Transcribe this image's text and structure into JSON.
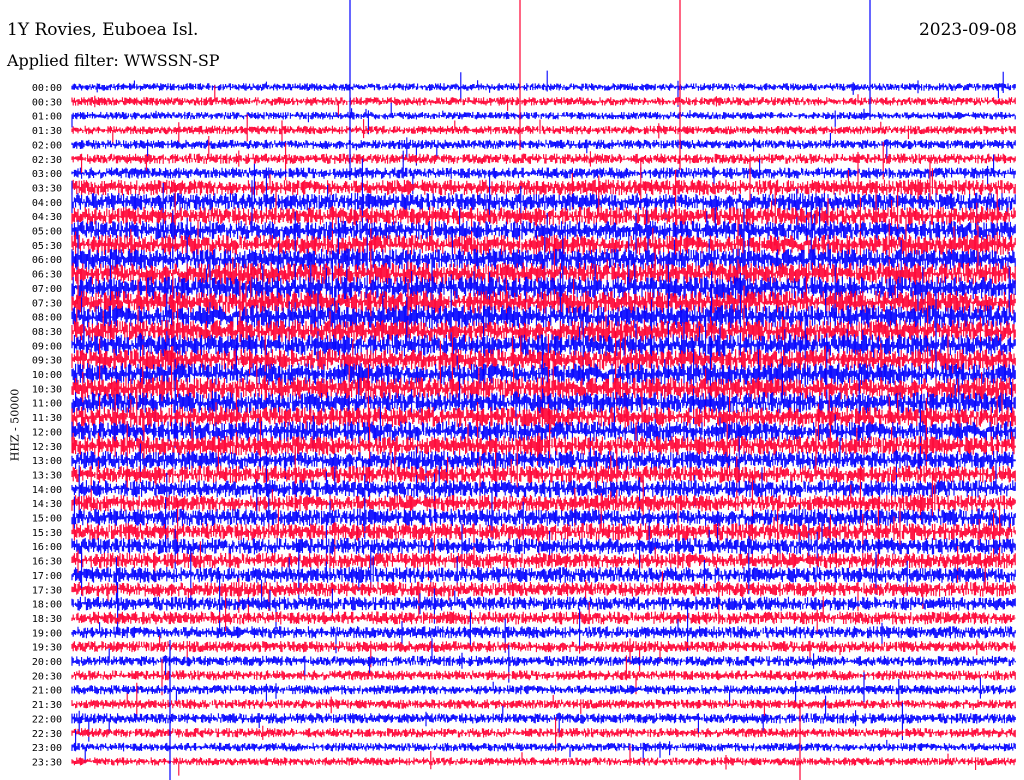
{
  "header": {
    "station": "1Y Rovies, Euboea Isl.",
    "filter": "Applied filter: WWSSN-SP",
    "date": "2023-09-08"
  },
  "chart_data": {
    "type": "line",
    "title": "1Y Rovies, Euboea Isl.",
    "ylabel": "HHZ - 50000",
    "row_labels": [
      "00:00",
      "00:30",
      "01:00",
      "01:30",
      "02:00",
      "02:30",
      "03:00",
      "03:30",
      "04:00",
      "04:30",
      "05:00",
      "05:30",
      "06:00",
      "06:30",
      "07:00",
      "07:30",
      "08:00",
      "08:30",
      "09:00",
      "09:30",
      "10:00",
      "10:30",
      "11:00",
      "11:30",
      "12:00",
      "12:30",
      "13:00",
      "13:30",
      "14:00",
      "14:30",
      "15:00",
      "15:30",
      "16:00",
      "16:30",
      "17:00",
      "17:30",
      "18:00",
      "18:30",
      "19:00",
      "19:30",
      "20:00",
      "20:30",
      "21:00",
      "21:30",
      "22:00",
      "22:30",
      "23:00",
      "23:30"
    ],
    "row_colors": [
      "#0000ff",
      "#ff0033"
    ],
    "activity": [
      0.15,
      0.2,
      0.15,
      0.2,
      0.25,
      0.3,
      0.35,
      0.6,
      0.7,
      0.75,
      0.8,
      0.85,
      0.9,
      0.95,
      1.0,
      1.0,
      1.0,
      0.95,
      0.95,
      0.9,
      0.95,
      0.95,
      0.9,
      0.85,
      0.85,
      0.8,
      0.75,
      0.7,
      0.7,
      0.65,
      0.7,
      0.7,
      0.65,
      0.6,
      0.6,
      0.55,
      0.5,
      0.45,
      0.4,
      0.35,
      0.3,
      0.28,
      0.25,
      0.25,
      0.3,
      0.25,
      0.2,
      0.18
    ],
    "grid": false
  }
}
